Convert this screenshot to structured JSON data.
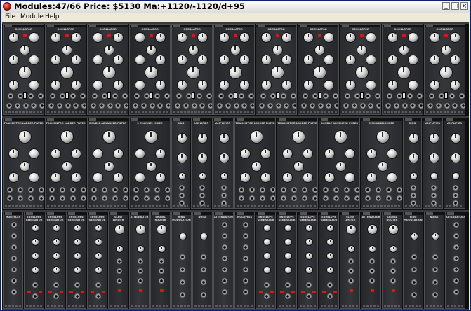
{
  "window": {
    "title": "Modules:47/66  Price: $5130  Ma:+1120/-1120/d+95",
    "controls": {
      "minimize": "_",
      "maximize": "□",
      "close": "×"
    }
  },
  "menubar": {
    "items": [
      "File",
      "Module",
      "Help"
    ]
  },
  "icons": {
    "app": "red-orb-icon",
    "knob": "knob-icon",
    "jack": "jack-icon"
  },
  "colors": {
    "rack": "#0e0e0f",
    "panel": "#2f3033",
    "led": "#d81b12",
    "knob": "#e6e6e6"
  },
  "rack": {
    "rows": [
      {
        "modules": [
          "OSCILLATOR",
          "OSCILLATOR",
          "OSCILLATOR",
          "OSCILLATOR",
          "OSCILLATOR",
          "OSCILLATOR",
          "OSCILLATOR",
          "OSCILLATOR",
          "OSCILLATOR",
          "OSCILLATOR",
          "OSCILLATOR"
        ],
        "kind": "osc"
      },
      {
        "modules": [
          "TRANSISTOR LADDER FILTER",
          "TRANSISTOR LADDER FILTER",
          "DOUBLE ADVANCED FILTER",
          "3 CHANNEL MIXER",
          "RING",
          "AMPLIFIER",
          "AMPLIFIER",
          "TRANSISTOR LADDER FILTER",
          "TRANSISTOR LADDER FILTER",
          "DOUBLE ADVANCED FILTER",
          "3 CHANNEL MIXER",
          "RING",
          "AMPLIFIER",
          "AMPLIFIER"
        ],
        "kind": "filter"
      },
      {
        "modules": [
          "MULTIPLES",
          "ENVELOPE GENERATOR",
          "ENVELOPE GENERATOR",
          "ENVELOPE GENERATOR",
          "ENVELOPE GENERATOR",
          "SLEW LIMITER",
          "ATTENUATOR",
          "SIGNAL ROUTER",
          "RING MODULATION",
          "NOISE",
          "ATTENUATORS",
          "MULTIPLES",
          "ENVELOPE GENERATOR",
          "ENVELOPE GENERATOR",
          "ENVELOPE GENERATOR",
          "ENVELOPE GENERATOR",
          "SLEW LIMITER",
          "ATTENUATOR",
          "SIGNAL ROUTER",
          "RING MODULATION",
          "NOISE",
          "ATTENUATORS"
        ],
        "kind": "util"
      }
    ]
  }
}
